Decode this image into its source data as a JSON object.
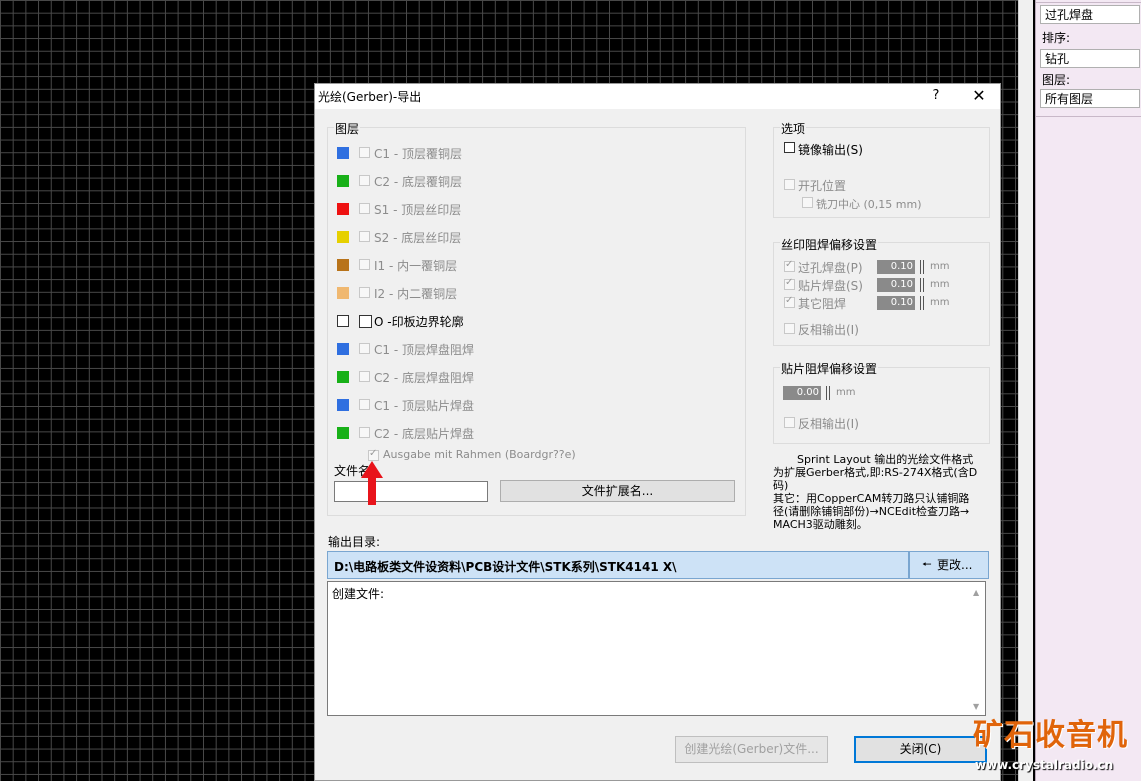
{
  "right_panel": {
    "field1": "过孔焊盘",
    "sort_label": "排序:",
    "sort_value": "钻孔",
    "layers_label": "图层:",
    "layers_value": "所有图层"
  },
  "dialog": {
    "title": "光绘(Gerber)-导出",
    "help": "?",
    "close": "✕",
    "layers_group": "图层",
    "layers": [
      {
        "label": "C1 - 顶层覆铜层",
        "color": "#2f6fe0",
        "checked": false,
        "enabled": false
      },
      {
        "label": "C2 - 底层覆铜层",
        "color": "#18b018",
        "checked": false,
        "enabled": false
      },
      {
        "label": "S1 - 顶层丝印层",
        "color": "#ee1111",
        "checked": false,
        "enabled": false
      },
      {
        "label": "S2 - 底层丝印层",
        "color": "#e6d000",
        "checked": false,
        "enabled": false
      },
      {
        "label": "I1 - 内一覆铜层",
        "color": "#b8731a",
        "checked": false,
        "enabled": false
      },
      {
        "label": "I2 - 内二覆铜层",
        "color": "#f0b870",
        "checked": false,
        "enabled": false
      },
      {
        "label": "O  -印板边界轮廓",
        "color": "#ffffff",
        "checked": false,
        "enabled": true
      },
      {
        "label": "C1 - 顶层焊盘阻焊",
        "color": "#2f6fe0",
        "checked": false,
        "enabled": false
      },
      {
        "label": "C2 - 底层焊盘阻焊",
        "color": "#18b018",
        "checked": false,
        "enabled": false
      },
      {
        "label": "C1 - 顶层贴片焊盘",
        "color": "#2f6fe0",
        "checked": false,
        "enabled": false
      },
      {
        "label": "C2 - 底层贴片焊盘",
        "color": "#18b018",
        "checked": false,
        "enabled": false
      }
    ],
    "frame_option": "Ausgabe mit Rahmen (Boardgr??e)",
    "filename_label": "文件名",
    "filename_value": "",
    "ext_button": "文件扩展名...",
    "options_group": "选项",
    "mirror": "镜像输出(S)",
    "drill_pos": "开孔位置",
    "mill_center": "铣刀中心 (0,15 mm)",
    "silk_group": "丝印阻焊偏移设置",
    "silk_items": [
      {
        "label": "过孔焊盘(P)",
        "value": "0.10",
        "unit": "mm"
      },
      {
        "label": "贴片焊盘(S)",
        "value": "0.10",
        "unit": "mm"
      },
      {
        "label": "其它阻焊",
        "value": "0.10",
        "unit": "mm"
      }
    ],
    "silk_invert": "反相输出(I)",
    "smd_group": "贴片阻焊偏移设置",
    "smd_value": "0.00",
    "smd_unit": "mm",
    "smd_invert": "反相输出(I)",
    "info_line1": "Sprint Layout 输出的光绘文件格式",
    "info_line2": "为扩展Gerber格式,即:RS-274X格式(含D",
    "info_line3": "码)",
    "info_line4": "其它：用CopperCAM转刀路只认铺铜路",
    "info_line5": "径(请删除铺铜部份)→NCEdit检查刀路→",
    "info_line6": "MACH3驱动雕刻。",
    "output_dir_label": "输出目录:",
    "output_dir": "D:\\电路板类文件设资料\\PCB设计文件\\STK系列\\STK4141 X\\",
    "change_button": "更改...",
    "log_text": "创建文件:",
    "create_button": "创建光绘(Gerber)文件...",
    "close_button": "关闭(C)"
  },
  "watermark": {
    "big": "矿石收音机",
    "small": "www.crystalradio.cn"
  },
  "colors": {
    "arrow": "#e8141b",
    "accent": "#0078d7"
  }
}
